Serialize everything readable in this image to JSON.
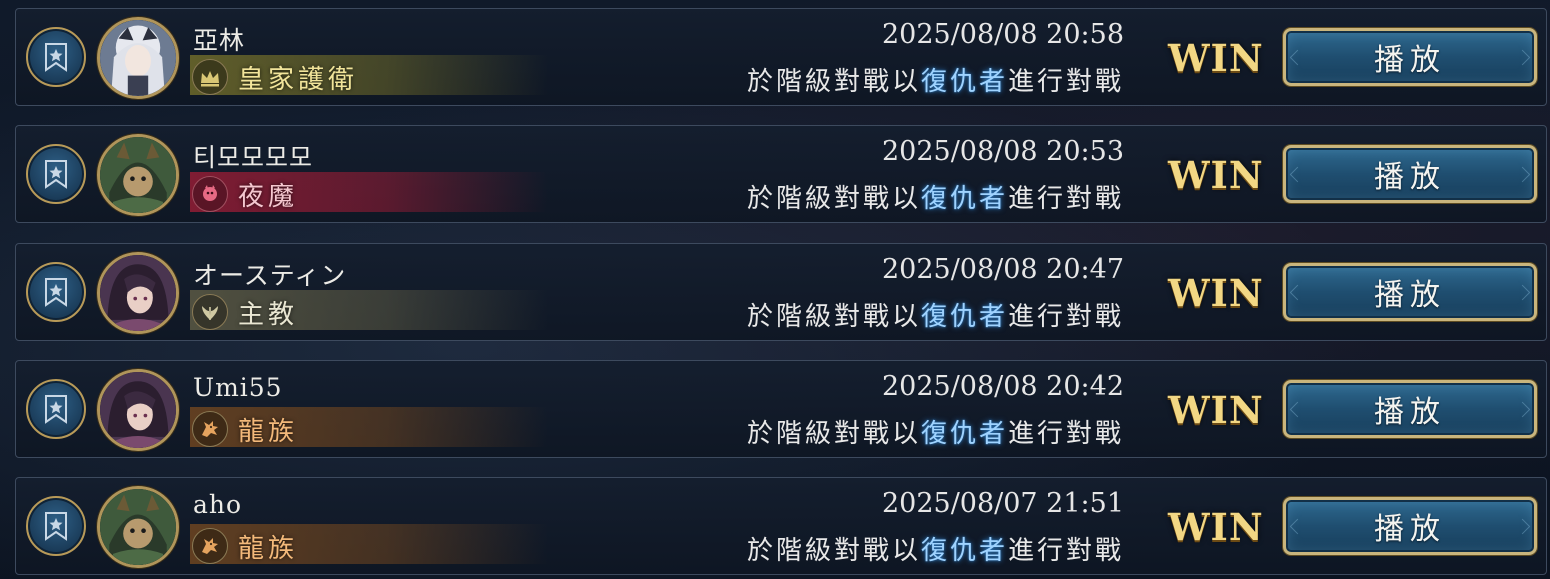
{
  "matches": [
    {
      "player_name": "亞林",
      "avatar_icon": "avatar-white-hair-icon",
      "class_name": "皇家護衛",
      "class_icon": "crown-icon",
      "class_color": "#f1e49a",
      "band_color": "#6e6a2a",
      "timestamp": "2025/08/08 20:58",
      "desc_prefix": "於階級對戰以",
      "desc_highlight": "復仇者",
      "desc_suffix": "進行對戰",
      "result": "WIN",
      "play_label": "播放"
    },
    {
      "player_name": "티모모모모",
      "avatar_icon": "avatar-hooded-icon",
      "class_name": "夜魔",
      "class_icon": "bat-icon",
      "class_color": "#f4c7cf",
      "band_color": "#7a1f33",
      "timestamp": "2025/08/08 20:53",
      "desc_prefix": "於階級對戰以",
      "desc_highlight": "復仇者",
      "desc_suffix": "進行對戰",
      "result": "WIN",
      "play_label": "播放"
    },
    {
      "player_name": "オースティン",
      "avatar_icon": "avatar-dark-hair-icon",
      "class_name": "主教",
      "class_icon": "wings-icon",
      "class_color": "#e9e6d2",
      "band_color": "#5c5a44",
      "timestamp": "2025/08/08 20:47",
      "desc_prefix": "於階級對戰以",
      "desc_highlight": "復仇者",
      "desc_suffix": "進行對戰",
      "result": "WIN",
      "play_label": "播放"
    },
    {
      "player_name": "Umi55",
      "avatar_icon": "avatar-dark-hair-icon",
      "class_name": "龍族",
      "class_icon": "dragon-icon",
      "class_color": "#f3b97a",
      "band_color": "#6e4520",
      "timestamp": "2025/08/08 20:42",
      "desc_prefix": "於階級對戰以",
      "desc_highlight": "復仇者",
      "desc_suffix": "進行對戰",
      "result": "WIN",
      "play_label": "播放"
    },
    {
      "player_name": "aho",
      "avatar_icon": "avatar-hooded-icon",
      "class_name": "龍族",
      "class_icon": "dragon-icon",
      "class_color": "#f3b97a",
      "band_color": "#6e4520",
      "timestamp": "2025/08/07 21:51",
      "desc_prefix": "於階級對戰以",
      "desc_highlight": "復仇者",
      "desc_suffix": "進行對戰",
      "result": "WIN",
      "play_label": "播放"
    }
  ],
  "colors": {
    "win_text": "#f2d784",
    "highlight_text": "#9fd3ff",
    "button_fill": "#1f4e70",
    "button_border": "#c9b57d"
  }
}
